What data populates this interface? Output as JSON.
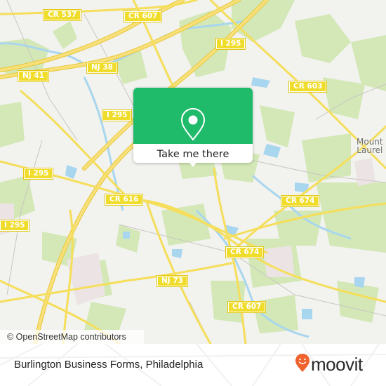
{
  "map": {
    "road_labels": [
      {
        "id": "cr537",
        "text": "CR 537"
      },
      {
        "id": "cr607-top",
        "text": "CR 607"
      },
      {
        "id": "i295-top",
        "text": "I 295"
      },
      {
        "id": "nj38",
        "text": "NJ 38"
      },
      {
        "id": "nj41",
        "text": "NJ 41"
      },
      {
        "id": "cr603",
        "text": "CR 603"
      },
      {
        "id": "i295-mid",
        "text": "I 295"
      },
      {
        "id": "i295-left",
        "text": "I 295"
      },
      {
        "id": "cr616",
        "text": "CR 616"
      },
      {
        "id": "cr674-right",
        "text": "CR 674"
      },
      {
        "id": "i295-bottom",
        "text": "I 295"
      },
      {
        "id": "cr674-center",
        "text": "CR 674"
      },
      {
        "id": "nj73",
        "text": "NJ 73"
      },
      {
        "id": "cr607-bottom",
        "text": "CR 607"
      }
    ],
    "place_labels": [
      {
        "id": "mount-laurel",
        "line1": "Mount",
        "line2": "Laurel"
      }
    ],
    "attribution": "© OpenStreetMap contributors",
    "colors": {
      "land": "#f2f2ee",
      "park": "#cfe6b0",
      "water": "#a9d6ef",
      "highway": "#f5de5a",
      "popup_green": "#1fba6a",
      "moovit_orange": "#f0622e"
    }
  },
  "popup": {
    "icon": "location-pin-icon",
    "cta_label": "Take me there"
  },
  "footer": {
    "title": "Burlington Business Forms, Philadelphia",
    "logo_text": "moovit",
    "logo_icon": "moovit-smile-pin-icon"
  }
}
